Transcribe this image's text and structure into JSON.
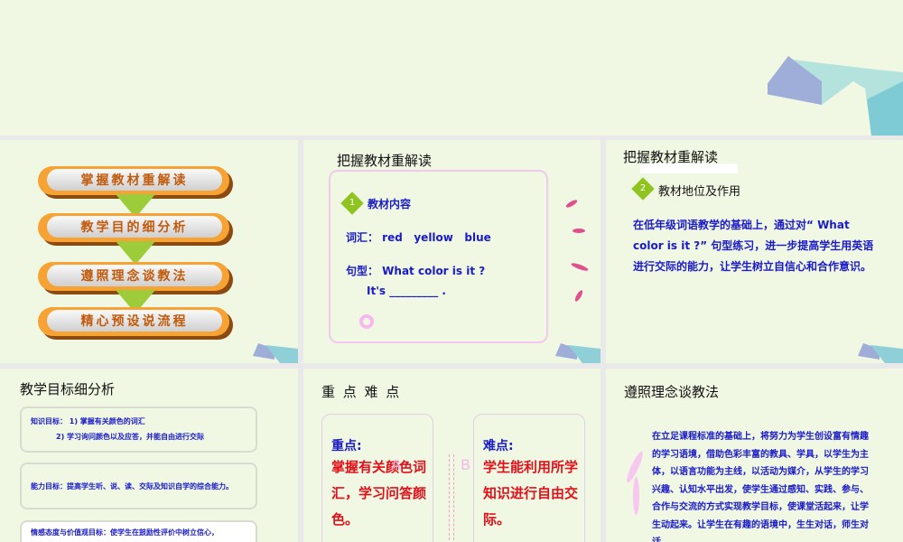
{
  "slide2": {
    "items": [
      "掌握教材重解读",
      "教学目的细分析",
      "遵照理念谈教法",
      "精心预设说流程"
    ]
  },
  "slide3": {
    "title": "把握教材重解读",
    "badge": "1",
    "heading": "教材内容",
    "vocab": "词汇： red   yellow   blue",
    "sentence": "句型： What color is it ?",
    "answer": "It's _________ ."
  },
  "slide4": {
    "title": "把握教材重解读",
    "badge": "2",
    "heading": "教材地位及作用",
    "body": "在低年级词语教学的基础上，通过对“ What color is it ?” 句型练习，进一步提高学生用英语进行交际的能力，让学生树立自信心和合作意识。"
  },
  "slide5": {
    "title": "教学目标细分析",
    "goal1a": "知识目标： 1) 掌握有关颜色的词汇",
    "goal1b": "2) 学习询问颜色以及应答，并能自由进行交际",
    "goal2": "能力目标：提高学生听、说、读、交际及知识自学的综合能力。",
    "goal3": "情感态度与价值观目标：使学生在鼓励性评价中树立信心，"
  },
  "slide6": {
    "title": "重 点 难 点",
    "left_label": "重点:",
    "left_text": "掌握有关颜色词汇，学习问答颜色。",
    "right_label": "难点:",
    "right_text": "学生能利用所学知识进行自由交际。",
    "a": "A",
    "b": "B"
  },
  "slide7": {
    "title": "遵照理念谈教法",
    "body": "在立足课程标准的基础上，将努力为学生创设富有情趣的学习语境，借助色彩丰富的教具、学具，以学生为主体，以语言功能为主线，以活动为媒介，从学生的学习兴趣、认知水平出发，使学生通过感知、实践、参与、合作与交流的方式实现教学目标，使课堂活起来，让学生动起来。让学生在有趣的语境中，生生对话，师生对话，"
  }
}
